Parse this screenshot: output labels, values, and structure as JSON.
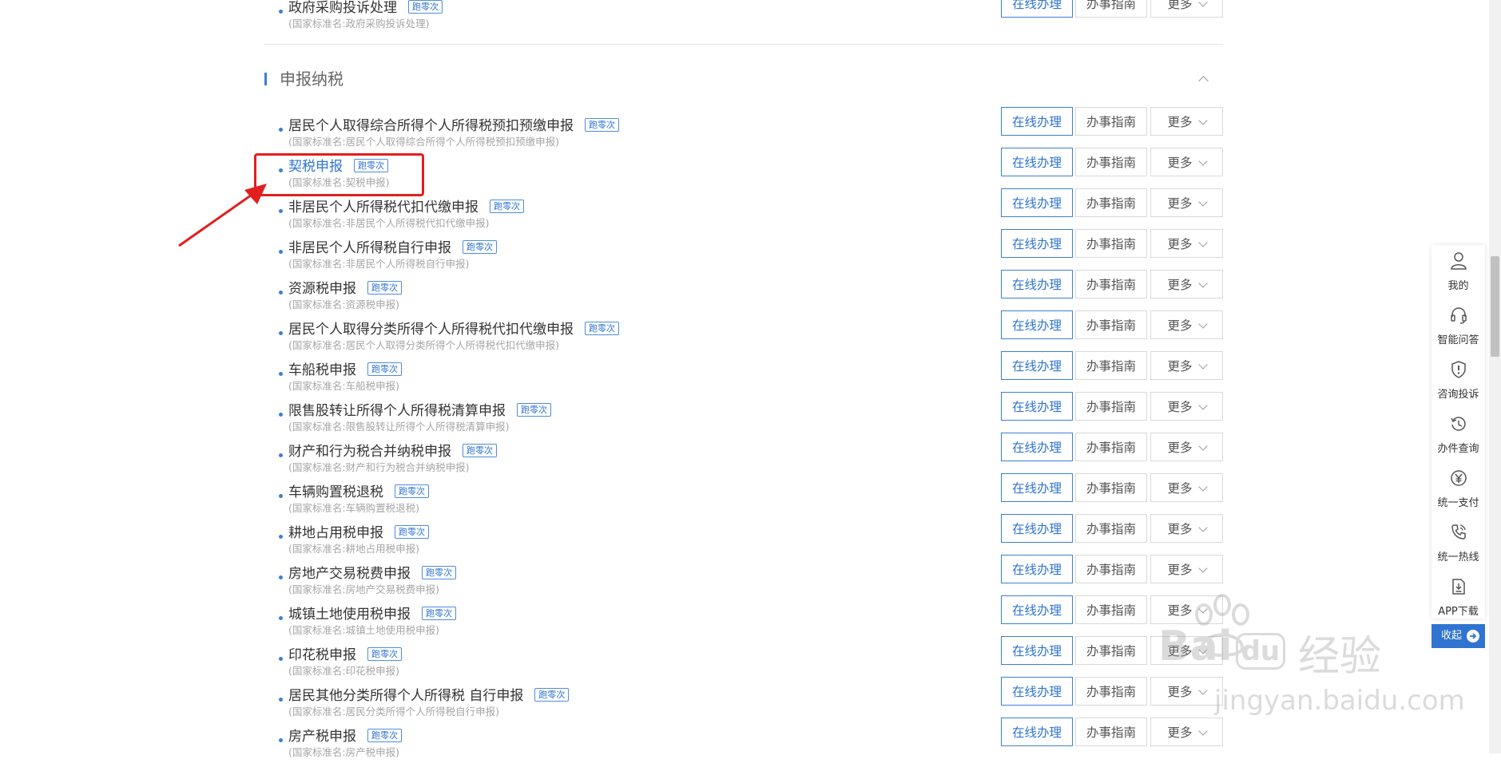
{
  "buttons": {
    "online": "在线办理",
    "guide": "办事指南",
    "more": "更多"
  },
  "badge": "跑零次",
  "top_item": {
    "title": "政府采购投诉处理",
    "std": "(国家标准名:政府采购投诉处理)"
  },
  "section": {
    "title": "申报纳税"
  },
  "items": [
    {
      "title": "居民个人取得综合所得个人所得税预扣预缴申报",
      "std": "(国家标准名:居民个人取得综合所得个人所得税预扣预缴申报)"
    },
    {
      "title": "契税申报",
      "std": "(国家标准名:契税申报)"
    },
    {
      "title": "非居民个人所得税代扣代缴申报",
      "std": "(国家标准名:非居民个人所得税代扣代缴申报)"
    },
    {
      "title": "非居民个人所得税自行申报",
      "std": "(国家标准名:非居民个人所得税自行申报)"
    },
    {
      "title": "资源税申报",
      "std": "(国家标准名:资源税申报)"
    },
    {
      "title": "居民个人取得分类所得个人所得税代扣代缴申报",
      "std": "(国家标准名:居民个人取得分类所得个人所得税代扣代缴申报)"
    },
    {
      "title": "车船税申报",
      "std": "(国家标准名:车船税申报)"
    },
    {
      "title": "限售股转让所得个人所得税清算申报",
      "std": "(国家标准名:限售股转让所得个人所得税清算申报)"
    },
    {
      "title": "财产和行为税合并纳税申报",
      "std": "(国家标准名:财产和行为税合并纳税申报)"
    },
    {
      "title": "车辆购置税退税",
      "std": "(国家标准名:车辆购置税退税)"
    },
    {
      "title": "耕地占用税申报",
      "std": "(国家标准名:耕地占用税申报)"
    },
    {
      "title": "房地产交易税费申报",
      "std": "(国家标准名:房地产交易税费申报)"
    },
    {
      "title": "城镇土地使用税申报",
      "std": "(国家标准名:城镇土地使用税申报)"
    },
    {
      "title": "印花税申报",
      "std": "(国家标准名:印花税申报)"
    },
    {
      "title": "居民其他分类所得个人所得税 自行申报",
      "std": "(国家标准名:居民分类所得个人所得税自行申报)"
    },
    {
      "title": "房产税申报",
      "std": "(国家标准名:房产税申报)"
    }
  ],
  "toolbar": [
    {
      "label": "我的",
      "icon": "user-icon"
    },
    {
      "label": "智能问答",
      "icon": "headset-icon"
    },
    {
      "label": "咨询投诉",
      "icon": "shield-alert-icon"
    },
    {
      "label": "办件查询",
      "icon": "history-icon"
    },
    {
      "label": "统一支付",
      "icon": "yuan-icon"
    },
    {
      "label": "统一热线",
      "icon": "phone-icon"
    },
    {
      "label": "APP下载",
      "icon": "download-icon"
    }
  ],
  "collapse_label": "收起",
  "watermark": {
    "brand": "Bai",
    "brand2": "du",
    "cn": "经验",
    "url": "jingyan.baidu.com"
  },
  "colors": {
    "accent": "#2f74d0",
    "highlight": "#e31e1e"
  }
}
